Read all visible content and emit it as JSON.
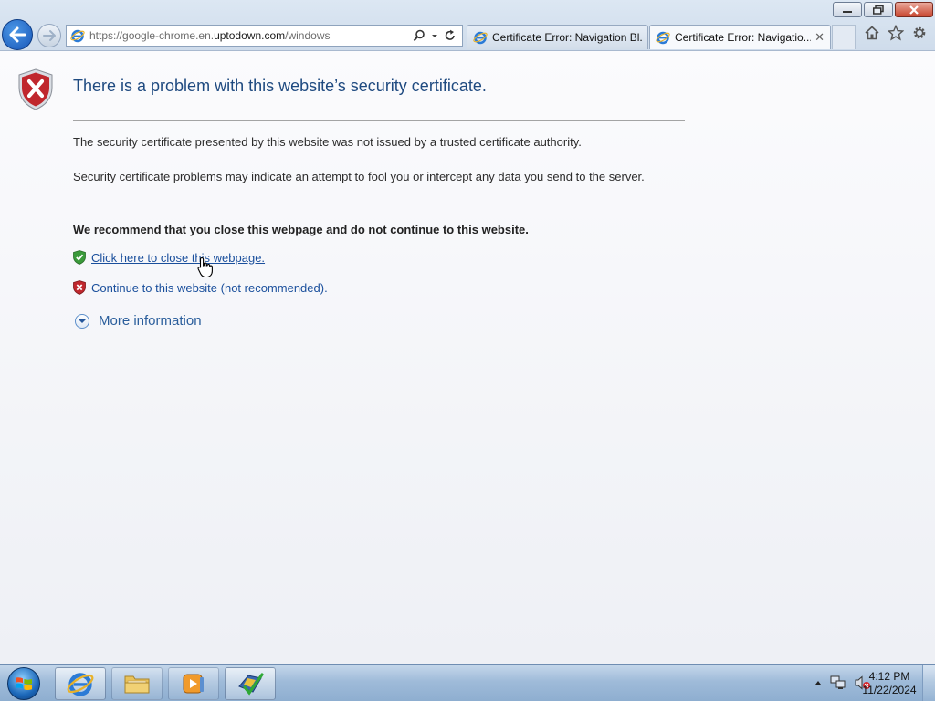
{
  "address_bar": {
    "url_prefix": "https://google-chrome.en.",
    "url_domain": "uptodown.com",
    "url_path": "/windows"
  },
  "tabs": [
    {
      "title": "Certificate Error: Navigation Bl...",
      "active": false
    },
    {
      "title": "Certificate Error: Navigatio...",
      "active": true,
      "close_glyph": "✕"
    }
  ],
  "page": {
    "title": "There is a problem with this website’s security certificate.",
    "para1": "The security certificate presented by this website was not issued by a trusted certificate authority.",
    "para2": "Security certificate problems may indicate an attempt to fool you or intercept any data you send to the server.",
    "recommend": "We recommend that you close this webpage and do not continue to this website.",
    "close_link": "Click here to close this webpage.",
    "continue_link": "Continue to this website (not recommended).",
    "more_info": "More information"
  },
  "taskbar": {
    "time": "4:12 PM",
    "date": "11/22/2024"
  },
  "colors": {
    "title": "#1f4a80",
    "link": "#1a4f9c",
    "shield_red": "#c0272d",
    "shield_green": "#3a9a3a"
  },
  "icons": [
    "minimize-icon",
    "restore-icon",
    "close-icon",
    "back-arrow-icon",
    "forward-arrow-icon",
    "ie-icon",
    "search-icon",
    "refresh-icon",
    "home-icon",
    "favorites-star-icon",
    "gear-icon",
    "shield-error-icon",
    "shield-ok-icon",
    "chevron-down-icon",
    "hand-cursor-icon",
    "windows-start-icon",
    "folder-icon",
    "media-player-icon",
    "action-center-icon",
    "network-icon",
    "speaker-muted-icon"
  ]
}
